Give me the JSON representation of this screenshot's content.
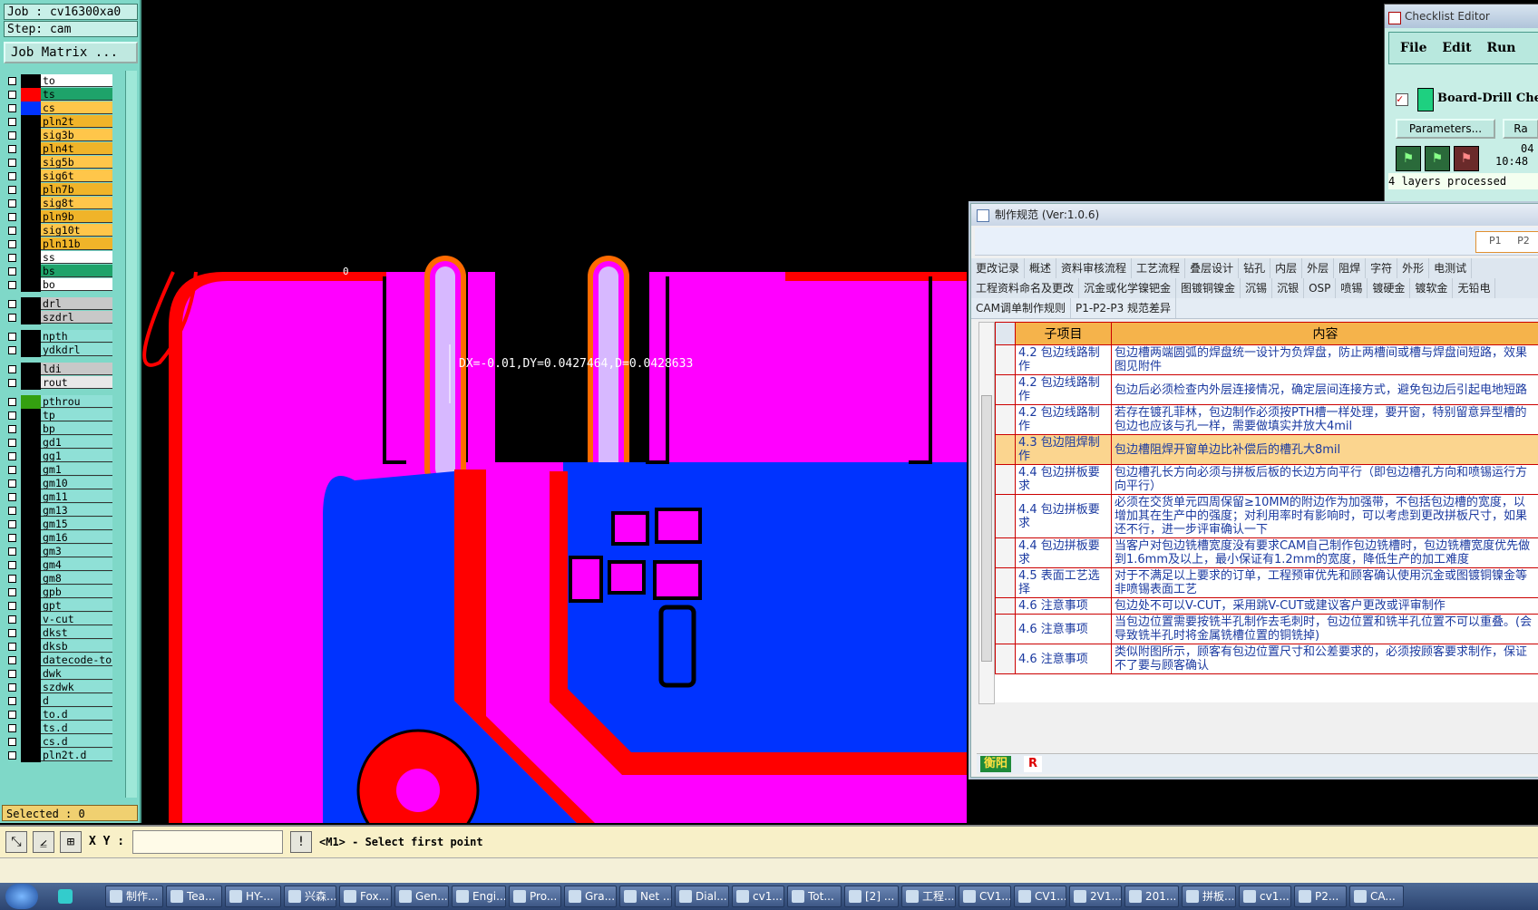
{
  "job_panel": {
    "job_line": "Job : cv16300xa0",
    "step_line": "Step: cam",
    "job_matrix_button": "Job Matrix ...",
    "selected_label": "Selected : 0",
    "layers": [
      {
        "name": "to",
        "color": "#ffffff"
      },
      {
        "name": "ts",
        "color": "#1ea36a"
      },
      {
        "name": "cs",
        "color": "#ffc64a"
      },
      {
        "name": "pln2t",
        "color": "#f0b429"
      },
      {
        "name": "sig3b",
        "color": "#ffc64a"
      },
      {
        "name": "pln4t",
        "color": "#f0b429"
      },
      {
        "name": "sig5b",
        "color": "#ffc64a"
      },
      {
        "name": "sig6t",
        "color": "#ffc64a"
      },
      {
        "name": "pln7b",
        "color": "#f0b429"
      },
      {
        "name": "sig8t",
        "color": "#ffc64a"
      },
      {
        "name": "pln9b",
        "color": "#f0b429"
      },
      {
        "name": "sig10t",
        "color": "#ffc64a"
      },
      {
        "name": "pln11b",
        "color": "#f0b429"
      },
      {
        "name": "ss",
        "color": "#ffffff"
      },
      {
        "name": "bs",
        "color": "#1ea36a"
      },
      {
        "name": "bo",
        "color": "#ffffff"
      },
      {
        "name": "drl",
        "color": "#c8c8c8"
      },
      {
        "name": "szdrl",
        "color": "#c8c8c8"
      },
      {
        "name": "npth",
        "color": "#8fe0d6"
      },
      {
        "name": "ydkdrl",
        "color": "#8fe0d6"
      },
      {
        "name": "ldi",
        "color": "#c8c8c8"
      },
      {
        "name": "rout",
        "color": "#e8e8e8"
      },
      {
        "name": "pthrou",
        "color": "#8fe0d6"
      },
      {
        "name": "tp",
        "color": "#8fe0d6"
      },
      {
        "name": "bp",
        "color": "#8fe0d6"
      },
      {
        "name": "gd1",
        "color": "#8fe0d6"
      },
      {
        "name": "gg1",
        "color": "#8fe0d6"
      },
      {
        "name": "gm1",
        "color": "#8fe0d6"
      },
      {
        "name": "gm10",
        "color": "#8fe0d6"
      },
      {
        "name": "gm11",
        "color": "#8fe0d6"
      },
      {
        "name": "gm13",
        "color": "#8fe0d6"
      },
      {
        "name": "gm15",
        "color": "#8fe0d6"
      },
      {
        "name": "gm16",
        "color": "#8fe0d6"
      },
      {
        "name": "gm3",
        "color": "#8fe0d6"
      },
      {
        "name": "gm4",
        "color": "#8fe0d6"
      },
      {
        "name": "gm8",
        "color": "#8fe0d6"
      },
      {
        "name": "gpb",
        "color": "#8fe0d6"
      },
      {
        "name": "gpt",
        "color": "#8fe0d6"
      },
      {
        "name": "v-cut",
        "color": "#8fe0d6"
      },
      {
        "name": "dkst",
        "color": "#8fe0d6"
      },
      {
        "name": "dksb",
        "color": "#8fe0d6"
      },
      {
        "name": "datecode-to",
        "color": "#8fe0d6"
      },
      {
        "name": "dwk",
        "color": "#8fe0d6"
      },
      {
        "name": "szdwk",
        "color": "#8fe0d6"
      },
      {
        "name": "d",
        "color": "#8fe0d6"
      },
      {
        "name": "to.d",
        "color": "#8fe0d6"
      },
      {
        "name": "ts.d",
        "color": "#8fe0d6"
      },
      {
        "name": "cs.d",
        "color": "#8fe0d6"
      },
      {
        "name": "pln2t.d",
        "color": "#8fe0d6"
      }
    ]
  },
  "canvas": {
    "measure_text": "DX=-0.01,DY=0.0427464,D=0.0428633",
    "zero_label": "0"
  },
  "command_bar": {
    "xy_label": "X Y :",
    "xy_value": "",
    "prompt": "<M1> - Select first point"
  },
  "checklist": {
    "title": "Checklist Editor",
    "menu": [
      "File",
      "Edit",
      "Run"
    ],
    "item": "Board-Drill Che",
    "params_button": "Parameters...",
    "ra_button": "Ra",
    "date": "04",
    "time": "10:48",
    "processed": "4 layers processed"
  },
  "spec_window": {
    "title": "制作规范 (Ver:1.0.6)",
    "p_checks": [
      "P1",
      "P2"
    ],
    "tabs_row1": [
      "更改记录",
      "概述",
      "资料审核流程",
      "工艺流程",
      "叠层设计",
      "钻孔",
      "内层",
      "外层",
      "阻焊",
      "字符",
      "外形",
      "电测试"
    ],
    "tabs_row2": [
      "工程资料命名及更改",
      "沉金或化学镍钯金",
      "图镀铜镍金",
      "沉锡",
      "沉银",
      "OSP",
      "喷锡",
      "镀硬金",
      "镀软金",
      "无铅电"
    ],
    "tabs_row3": [
      "CAM调单制作规则",
      "P1-P2-P3 规范差异"
    ],
    "col_sub": "子项目",
    "col_content": "内容",
    "rows": [
      {
        "sub": "4.2 包边线路制作",
        "content": "包边槽两端圆弧的焊盘统一设计为负焊盘，防止两槽间或槽与焊盘间短路，效果图见附件"
      },
      {
        "sub": "4.2 包边线路制作",
        "content": "包边后必须检查内外层连接情况，确定层间连接方式，避免包边后引起电地短路"
      },
      {
        "sub": "4.2 包边线路制作",
        "content": "若存在镀孔菲林，包边制作必须按PTH槽一样处理，要开窗，特别留意异型槽的包边也应该与孔一样，需要做填实并放大4mil"
      },
      {
        "sub": "4.3 包边阻焊制作",
        "content": "包边槽阻焊开窗单边比补偿后的槽孔大8mil",
        "highlight": true
      },
      {
        "sub": "4.4 包边拼板要求",
        "content": "包边槽孔长方向必须与拼板后板的长边方向平行（即包边槽孔方向和喷锡运行方向平行）"
      },
      {
        "sub": "4.4 包边拼板要求",
        "content": "必须在交货单元四周保留≥10MM的附边作为加强带，不包括包边槽的宽度，以增加其在生产中的强度；对利用率时有影响时，可以考虑到更改拼板尺寸，如果还不行，进一步评审确认一下"
      },
      {
        "sub": "4.4 包边拼板要求",
        "content": "当客户对包边铣槽宽度没有要求CAM自己制作包边铣槽时，包边铣槽宽度优先做到1.6mm及以上，最小保证有1.2mm的宽度，降低生产的加工难度"
      },
      {
        "sub": "4.5 表面工艺选择",
        "content": "对于不满足以上要求的订单，工程预审优先和顾客确认使用沉金或图镀铜镍金等非喷锡表面工艺"
      },
      {
        "sub": "4.6 注意事项",
        "content": "包边处不可以V-CUT，采用跳V-CUT或建议客户更改或评审制作"
      },
      {
        "sub": "4.6 注意事项",
        "content": "当包边位置需要按铣半孔制作去毛刺时，包边位置和铣半孔位置不可以重叠。(会导致铣半孔时将金属铣槽位置的铜铣掉)"
      },
      {
        "sub": "4.6 注意事项",
        "content": "类似附图所示，顾客有包边位置尺寸和公差要求的，必须按顾客要求制作，保证不了要与顾客确认"
      }
    ],
    "footer_site": "衡阳",
    "footer_r": "R"
  },
  "taskbar": {
    "buttons": [
      "制作...",
      "Tea...",
      "HY-...",
      "兴森...",
      "Fox...",
      "Gen...",
      "Engi...",
      "Pro...",
      "Gra...",
      "Net ...",
      "Dial...",
      "cv1...",
      "Tot...",
      "[2] ...",
      "工程...",
      "CV1...",
      "CV1...",
      "2V1...",
      "201...",
      "拼板...",
      "cv1...",
      "P2...",
      "CA..."
    ]
  }
}
